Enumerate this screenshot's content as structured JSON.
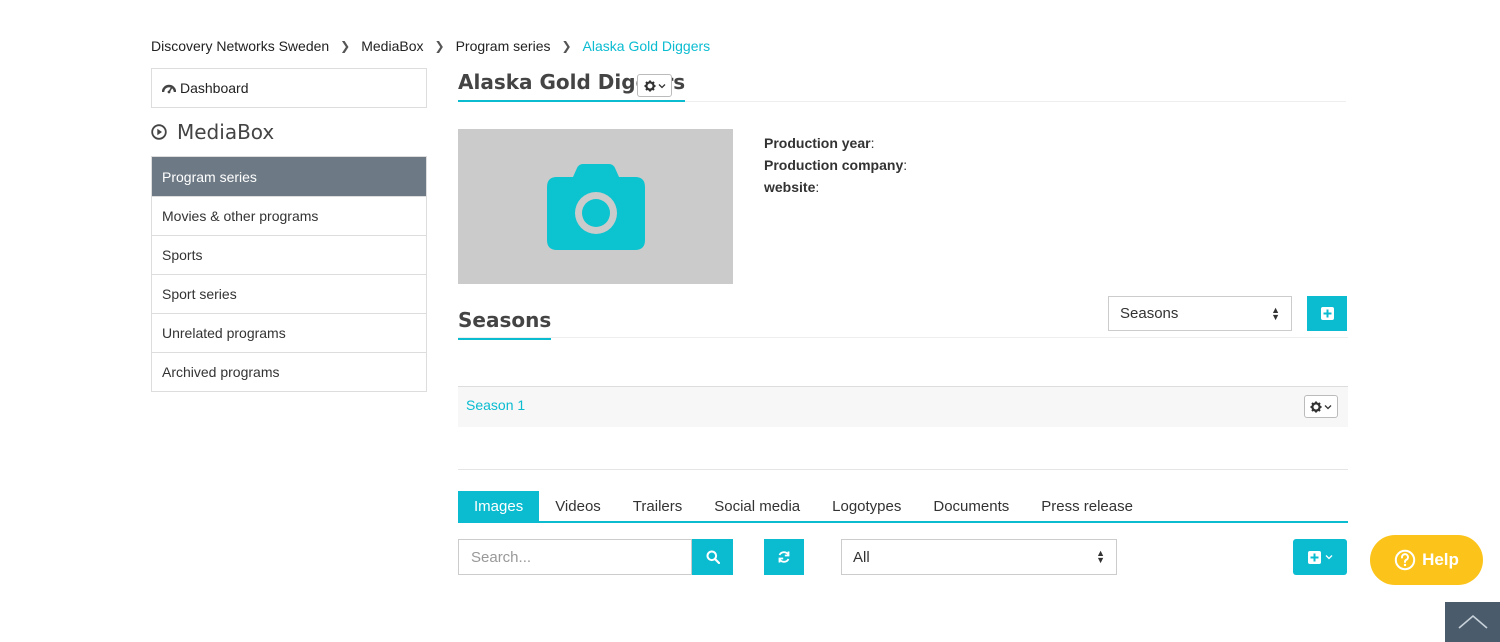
{
  "breadcrumb": {
    "items": [
      "Discovery Networks Sweden",
      "MediaBox",
      "Program series"
    ],
    "current": "Alaska Gold Diggers"
  },
  "sidebar": {
    "dashboard_label": "Dashboard",
    "section_title": "MediaBox",
    "items": [
      {
        "label": "Program series",
        "active": true
      },
      {
        "label": "Movies & other programs"
      },
      {
        "label": "Sports"
      },
      {
        "label": "Sport series"
      },
      {
        "label": "Unrelated programs"
      },
      {
        "label": "Archived programs"
      }
    ]
  },
  "program": {
    "title": "Alaska Gold Diggers",
    "fields": [
      {
        "label": "Production year",
        "value": ""
      },
      {
        "label": "Production company",
        "value": ""
      },
      {
        "label": "website",
        "value": ""
      }
    ]
  },
  "seasons": {
    "title": "Seasons",
    "select_value": "Seasons",
    "rows": [
      "Season 1"
    ]
  },
  "media_tabs": {
    "tabs": [
      "Images",
      "Videos",
      "Trailers",
      "Social media",
      "Logotypes",
      "Documents",
      "Press release"
    ],
    "active": "Images"
  },
  "filters": {
    "search_placeholder": "Search...",
    "filter_value": "All"
  },
  "help": {
    "label": "Help"
  },
  "colors": {
    "accent": "#0bbcd1",
    "active_nav": "#6d7a85",
    "help": "#fcc41a",
    "scroll_top": "#4a5c6c"
  }
}
